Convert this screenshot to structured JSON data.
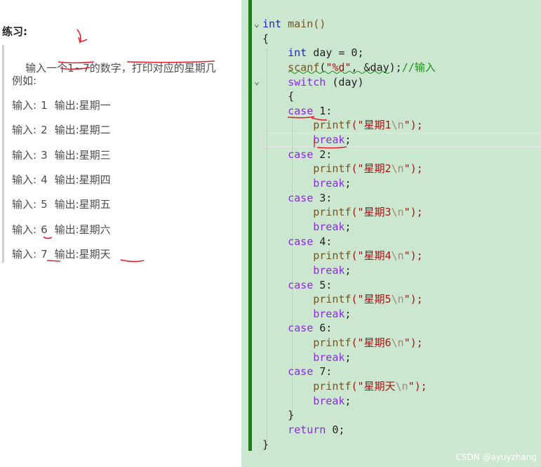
{
  "exercise": {
    "title": "练习:",
    "task": {
      "p1": "输入一个",
      "p2": "1~7的",
      "p3": "数字，",
      "p4": "打印对应的星期几"
    },
    "example_label": "例如:",
    "rows": [
      {
        "in_label": "输入:",
        "num": "1",
        "out_label": "输出:",
        "week": "星期一"
      },
      {
        "in_label": "输入:",
        "num": "2",
        "out_label": "输出:",
        "week": "星期二"
      },
      {
        "in_label": "输入:",
        "num": "3",
        "out_label": "输出:",
        "week": "星期三"
      },
      {
        "in_label": "输入:",
        "num": "4",
        "out_label": "输出:",
        "week": "星期四"
      },
      {
        "in_label": "输入:",
        "num": "5",
        "out_label": "输出:",
        "week": "星期五"
      },
      {
        "in_label": "输入:",
        "num": "6",
        "out_label": "输出:",
        "week": "星期六"
      },
      {
        "in_label": "输入:",
        "num": "7",
        "out_label": "输出:",
        "week": "星期天"
      }
    ]
  },
  "code": {
    "l1": {
      "kw": "int",
      "fn": " main()"
    },
    "l2": "{",
    "l3": {
      "kw": "int",
      "rest": " day = 0;"
    },
    "l4": {
      "fn": "scanf",
      "a": "(",
      "str": "\"%d\"",
      "b": ", &day);",
      "cm": "//输入"
    },
    "l5": {
      "kw": "switch",
      "rest": " (day)"
    },
    "l6": "{",
    "cases": [
      {
        "kw": "case",
        "val": " 1:",
        "fn": "printf",
        "str1": "(\"星期1",
        "esc": "\\n",
        "str2": "\");",
        "brk": "break",
        "semi": ";"
      },
      {
        "kw": "case",
        "val": " 2:",
        "fn": "printf",
        "str1": "(\"星期2",
        "esc": "\\n",
        "str2": "\");",
        "brk": "break",
        "semi": ";"
      },
      {
        "kw": "case",
        "val": " 3:",
        "fn": "printf",
        "str1": "(\"星期3",
        "esc": "\\n",
        "str2": "\");",
        "brk": "break",
        "semi": ";"
      },
      {
        "kw": "case",
        "val": " 4:",
        "fn": "printf",
        "str1": "(\"星期4",
        "esc": "\\n",
        "str2": "\");",
        "brk": "break",
        "semi": ";"
      },
      {
        "kw": "case",
        "val": " 5:",
        "fn": "printf",
        "str1": "(\"星期5",
        "esc": "\\n",
        "str2": "\");",
        "brk": "break",
        "semi": ";"
      },
      {
        "kw": "case",
        "val": " 6:",
        "fn": "printf",
        "str1": "(\"星期6",
        "esc": "\\n",
        "str2": "\");",
        "brk": "break",
        "semi": ";"
      },
      {
        "kw": "case",
        "val": " 7:",
        "fn": "printf",
        "str1": "(\"星期天",
        "esc": "\\n",
        "str2": "\");",
        "brk": "break",
        "semi": ";"
      }
    ],
    "close_switch": "}",
    "ret": {
      "kw": "return",
      "rest": " 0;"
    },
    "close_main": "}"
  },
  "watermark": "CSDN @ayuyzhang",
  "colors": {
    "editor_bg": "#cce7cf",
    "keyword": "#2222cc",
    "control": "#8a2be2",
    "string": "#a31515",
    "comment": "#1f8f1f",
    "annotation": "#e0202a"
  }
}
